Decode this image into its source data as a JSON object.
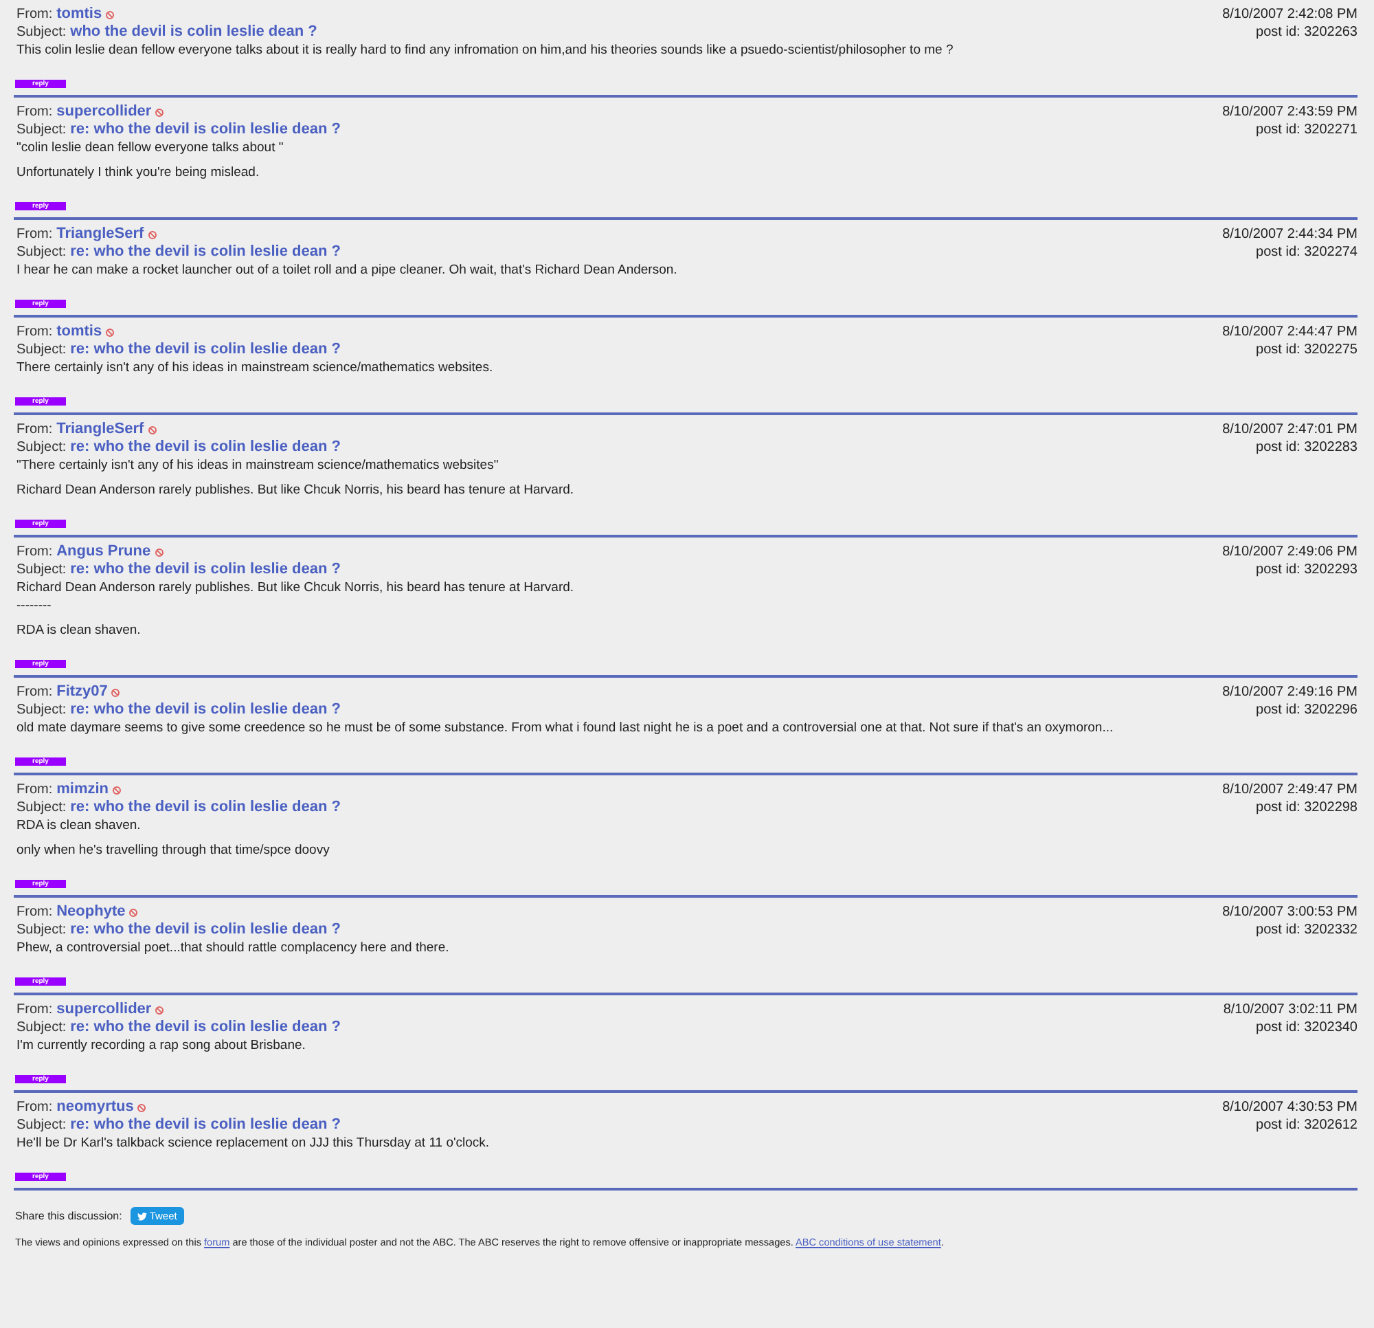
{
  "posts": [
    {
      "from_label": "From:",
      "from": "tomtis",
      "subject_label": "Subject:",
      "subject": "who the devil is colin leslie dean ?",
      "date": "8/10/2007 2:42:08 PM",
      "post_id": "post id: 3202263",
      "body": [
        [
          "This colin leslie dean fellow everyone talks about it is really hard to find any infromation on him,and his theories sounds like a psuedo-scientist/philosopher to me ?"
        ]
      ],
      "reply": "reply"
    },
    {
      "from_label": "From:",
      "from": "supercollider",
      "subject_label": "Subject:",
      "subject": "re: who the devil is colin leslie dean ?",
      "date": "8/10/2007 2:43:59 PM",
      "post_id": "post id: 3202271",
      "body": [
        [
          "\"colin leslie dean fellow everyone talks about \""
        ],
        [
          "Unfortunately I think you're being mislead."
        ]
      ],
      "reply": "reply"
    },
    {
      "from_label": "From:",
      "from": "TriangleSerf",
      "subject_label": "Subject:",
      "subject": "re: who the devil is colin leslie dean ?",
      "date": "8/10/2007 2:44:34 PM",
      "post_id": "post id: 3202274",
      "body": [
        [
          "I hear he can make a rocket launcher out of a toilet roll and a pipe cleaner. Oh wait, that's Richard Dean Anderson."
        ]
      ],
      "reply": "reply"
    },
    {
      "from_label": "From:",
      "from": "tomtis",
      "subject_label": "Subject:",
      "subject": "re: who the devil is colin leslie dean ?",
      "date": "8/10/2007 2:44:47 PM",
      "post_id": "post id: 3202275",
      "body": [
        [
          "There certainly isn't any of his ideas in mainstream science/mathematics websites."
        ]
      ],
      "reply": "reply"
    },
    {
      "from_label": "From:",
      "from": "TriangleSerf",
      "subject_label": "Subject:",
      "subject": "re: who the devil is colin leslie dean ?",
      "date": "8/10/2007 2:47:01 PM",
      "post_id": "post id: 3202283",
      "body": [
        [
          "\"There certainly isn't any of his ideas in mainstream science/mathematics websites\""
        ],
        [
          "Richard Dean Anderson rarely publishes. But like Chcuk Norris, his beard has tenure at Harvard."
        ]
      ],
      "reply": "reply"
    },
    {
      "from_label": "From:",
      "from": "Angus Prune",
      "subject_label": "Subject:",
      "subject": "re: who the devil is colin leslie dean ?",
      "date": "8/10/2007 2:49:06 PM",
      "post_id": "post id: 3202293",
      "body": [
        [
          "Richard Dean Anderson rarely publishes. But like Chcuk Norris, his beard has tenure at Harvard.",
          "--------"
        ],
        [
          "RDA is clean shaven."
        ]
      ],
      "reply": "reply"
    },
    {
      "from_label": "From:",
      "from": "Fitzy07",
      "subject_label": "Subject:",
      "subject": "re: who the devil is colin leslie dean ?",
      "date": "8/10/2007 2:49:16 PM",
      "post_id": "post id: 3202296",
      "body": [
        [
          "old mate daymare seems to give some creedence so he must be of some substance. From what i found last night he is a poet and a controversial one at that. Not sure if that's an oxymoron..."
        ]
      ],
      "reply": "reply"
    },
    {
      "from_label": "From:",
      "from": "mimzin",
      "subject_label": "Subject:",
      "subject": "re: who the devil is colin leslie dean ?",
      "date": "8/10/2007 2:49:47 PM",
      "post_id": "post id: 3202298",
      "body": [
        [
          "RDA is clean shaven."
        ],
        [
          "only when he's travelling through that time/spce doovy"
        ]
      ],
      "reply": "reply"
    },
    {
      "from_label": "From:",
      "from": "Neophyte",
      "subject_label": "Subject:",
      "subject": "re: who the devil is colin leslie dean ?",
      "date": "8/10/2007 3:00:53 PM",
      "post_id": "post id: 3202332",
      "body": [
        [
          "Phew, a controversial poet...that should rattle complacency here and there."
        ]
      ],
      "reply": "reply"
    },
    {
      "from_label": "From:",
      "from": "supercollider",
      "subject_label": "Subject:",
      "subject": "re: who the devil is colin leslie dean ?",
      "date": "8/10/2007 3:02:11 PM",
      "post_id": "post id: 3202340",
      "body": [
        [
          "I'm currently recording a rap song about Brisbane."
        ]
      ],
      "reply": "reply"
    },
    {
      "from_label": "From:",
      "from": "neomyrtus",
      "subject_label": "Subject:",
      "subject": "re: who the devil is colin leslie dean ?",
      "date": "8/10/2007 4:30:53 PM",
      "post_id": "post id: 3202612",
      "body": [
        [
          "He'll be Dr Karl's talkback science replacement on JJJ this Thursday at 11 o'clock."
        ]
      ],
      "reply": "reply"
    }
  ],
  "share": {
    "label": "Share this discussion:",
    "button": "Tweet"
  },
  "disclaimer": {
    "before": "The views and opinions expressed on this",
    "link1": "forum",
    "middle": "are those of the individual poster and not the ABC. The ABC reserves the right to remove offensive or inappropriate messages.",
    "link2": "ABC conditions of use statement",
    "after": "."
  }
}
